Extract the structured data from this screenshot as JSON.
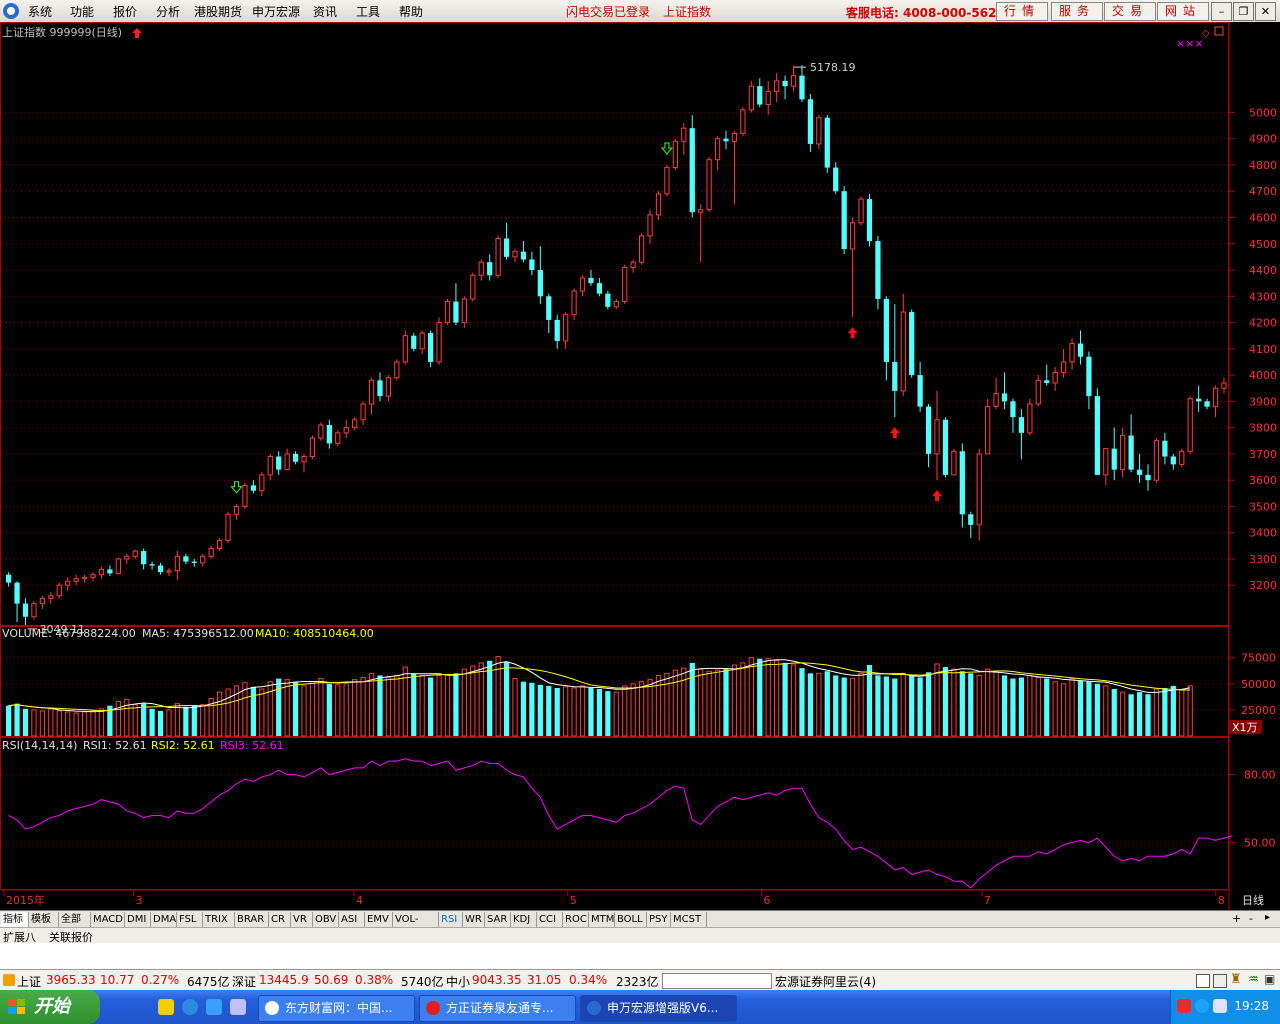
{
  "menubar": {
    "items": [
      "系统",
      "功能",
      "报价",
      "分析",
      "港股期货",
      "申万宏源",
      "资讯",
      "工具",
      "帮助"
    ],
    "status_login": "闪电交易已登录",
    "status_index": "上证指数",
    "service_phone": "客服电话: 4008-000-562",
    "nav_buttons": [
      "行情",
      "服务",
      "交易",
      "网站"
    ]
  },
  "chart_header": {
    "title": "上证指数 999999(日线)"
  },
  "volume_header": {
    "volume": "VOLUME: 467988224.00",
    "ma5": "MA5: 475396512.00",
    "ma10": "MA10: 408510464.00",
    "unit": "X1万"
  },
  "rsi_header": {
    "name": "RSI(14,14,14)",
    "rsi1": "RSI1: 52.61",
    "rsi2": "RSI2: 52.61",
    "rsi3": "RSI3: 52.61"
  },
  "chart_data": {
    "type": "candlestick",
    "title": "上证指数 999999(日线)",
    "price_axis": {
      "ticks": [
        3200,
        3300,
        3400,
        3500,
        3600,
        3700,
        3800,
        3900,
        4000,
        4100,
        4200,
        4300,
        4400,
        4500,
        4600,
        4700,
        4800,
        4900,
        5000
      ],
      "range": [
        3060,
        5230
      ]
    },
    "high_label": "5178.19",
    "low_label": "3049.11",
    "volume_axis": {
      "ticks": [
        "25000",
        "50000",
        "75000"
      ],
      "range": [
        0,
        90000
      ]
    },
    "rsi_axis": {
      "ticks": [
        "50.00",
        "80.00"
      ],
      "range": [
        30,
        90
      ]
    },
    "x_labels": [
      "2015年",
      "3",
      "4",
      "5",
      "6",
      "7",
      "8"
    ],
    "period_label": "日线",
    "ohlc": [
      [
        3240,
        3250,
        3195,
        3210
      ],
      [
        3210,
        3215,
        3060,
        3130
      ],
      [
        3130,
        3150,
        3049,
        3080
      ],
      [
        3080,
        3140,
        3070,
        3130
      ],
      [
        3130,
        3160,
        3110,
        3150
      ],
      [
        3150,
        3175,
        3130,
        3160
      ],
      [
        3160,
        3210,
        3150,
        3200
      ],
      [
        3200,
        3230,
        3180,
        3215
      ],
      [
        3215,
        3240,
        3200,
        3225
      ],
      [
        3225,
        3240,
        3210,
        3230
      ],
      [
        3230,
        3250,
        3215,
        3240
      ],
      [
        3240,
        3270,
        3225,
        3260
      ],
      [
        3260,
        3275,
        3235,
        3245
      ],
      [
        3245,
        3305,
        3240,
        3300
      ],
      [
        3300,
        3320,
        3280,
        3310
      ],
      [
        3310,
        3335,
        3300,
        3330
      ],
      [
        3330,
        3340,
        3260,
        3280
      ],
      [
        3280,
        3290,
        3260,
        3275
      ],
      [
        3275,
        3285,
        3240,
        3250
      ],
      [
        3250,
        3265,
        3235,
        3255
      ],
      [
        3255,
        3330,
        3220,
        3310
      ],
      [
        3310,
        3320,
        3280,
        3290
      ],
      [
        3290,
        3300,
        3270,
        3285
      ],
      [
        3285,
        3320,
        3270,
        3310
      ],
      [
        3310,
        3350,
        3300,
        3340
      ],
      [
        3340,
        3380,
        3330,
        3370
      ],
      [
        3370,
        3480,
        3360,
        3470
      ],
      [
        3470,
        3510,
        3450,
        3500
      ],
      [
        3500,
        3590,
        3490,
        3580
      ],
      [
        3580,
        3600,
        3550,
        3560
      ],
      [
        3560,
        3630,
        3540,
        3620
      ],
      [
        3620,
        3700,
        3600,
        3690
      ],
      [
        3690,
        3710,
        3620,
        3640
      ],
      [
        3640,
        3720,
        3640,
        3700
      ],
      [
        3700,
        3710,
        3660,
        3670
      ],
      [
        3670,
        3700,
        3630,
        3690
      ],
      [
        3690,
        3770,
        3680,
        3760
      ],
      [
        3760,
        3820,
        3750,
        3810
      ],
      [
        3810,
        3830,
        3720,
        3740
      ],
      [
        3740,
        3790,
        3730,
        3780
      ],
      [
        3780,
        3830,
        3760,
        3800
      ],
      [
        3800,
        3840,
        3790,
        3830
      ],
      [
        3830,
        3900,
        3810,
        3890
      ],
      [
        3890,
        3990,
        3850,
        3980
      ],
      [
        3980,
        4010,
        3900,
        3920
      ],
      [
        3920,
        4000,
        3900,
        3990
      ],
      [
        3990,
        4060,
        3980,
        4050
      ],
      [
        4050,
        4170,
        4040,
        4150
      ],
      [
        4150,
        4160,
        4090,
        4100
      ],
      [
        4100,
        4170,
        4080,
        4160
      ],
      [
        4160,
        4170,
        4030,
        4050
      ],
      [
        4050,
        4220,
        4040,
        4200
      ],
      [
        4200,
        4290,
        4190,
        4280
      ],
      [
        4280,
        4350,
        4190,
        4200
      ],
      [
        4200,
        4300,
        4180,
        4290
      ],
      [
        4290,
        4390,
        4280,
        4380
      ],
      [
        4380,
        4440,
        4360,
        4430
      ],
      [
        4430,
        4460,
        4360,
        4380
      ],
      [
        4380,
        4530,
        4370,
        4520
      ],
      [
        4520,
        4580,
        4440,
        4450
      ],
      [
        4450,
        4480,
        4430,
        4470
      ],
      [
        4470,
        4510,
        4430,
        4440
      ],
      [
        4440,
        4470,
        4380,
        4400
      ],
      [
        4400,
        4490,
        4270,
        4300
      ],
      [
        4300,
        4310,
        4160,
        4210
      ],
      [
        4210,
        4230,
        4100,
        4130
      ],
      [
        4130,
        4240,
        4100,
        4230
      ],
      [
        4230,
        4330,
        4210,
        4320
      ],
      [
        4320,
        4380,
        4300,
        4370
      ],
      [
        4370,
        4400,
        4340,
        4350
      ],
      [
        4350,
        4370,
        4300,
        4310
      ],
      [
        4310,
        4320,
        4250,
        4260
      ],
      [
        4260,
        4290,
        4250,
        4280
      ],
      [
        4280,
        4420,
        4270,
        4410
      ],
      [
        4410,
        4440,
        4390,
        4430
      ],
      [
        4430,
        4540,
        4420,
        4530
      ],
      [
        4530,
        4630,
        4500,
        4610
      ],
      [
        4610,
        4700,
        4590,
        4690
      ],
      [
        4690,
        4800,
        4680,
        4790
      ],
      [
        4790,
        4900,
        4780,
        4890
      ],
      [
        4890,
        4960,
        4840,
        4940
      ],
      [
        4940,
        4990,
        4600,
        4620
      ],
      [
        4620,
        4650,
        4430,
        4630
      ],
      [
        4630,
        4830,
        4620,
        4820
      ],
      [
        4820,
        4910,
        4780,
        4900
      ],
      [
        4900,
        4930,
        4860,
        4890
      ],
      [
        4890,
        4930,
        4650,
        4920
      ],
      [
        4920,
        5020,
        4910,
        5010
      ],
      [
        5010,
        5120,
        5000,
        5100
      ],
      [
        5100,
        5130,
        5020,
        5030
      ],
      [
        5030,
        5120,
        4990,
        5080
      ],
      [
        5080,
        5150,
        5040,
        5120
      ],
      [
        5120,
        5140,
        5050,
        5100
      ],
      [
        5100,
        5178,
        5080,
        5140
      ],
      [
        5140,
        5180,
        5040,
        5050
      ],
      [
        5050,
        5070,
        4850,
        4880
      ],
      [
        4880,
        4990,
        4860,
        4980
      ],
      [
        4980,
        4990,
        4770,
        4790
      ],
      [
        4790,
        4810,
        4690,
        4700
      ],
      [
        4700,
        4720,
        4460,
        4480
      ],
      [
        4480,
        4600,
        4220,
        4580
      ],
      [
        4580,
        4680,
        4570,
        4670
      ],
      [
        4670,
        4690,
        4490,
        4510
      ],
      [
        4510,
        4530,
        4250,
        4290
      ],
      [
        4290,
        4300,
        3980,
        4050
      ],
      [
        4050,
        4270,
        3840,
        3940
      ],
      [
        3940,
        4310,
        3920,
        4240
      ],
      [
        4240,
        4250,
        3990,
        4000
      ],
      [
        4000,
        4050,
        3860,
        3880
      ],
      [
        3880,
        3890,
        3650,
        3700
      ],
      [
        3700,
        3940,
        3600,
        3830
      ],
      [
        3830,
        3840,
        3610,
        3620
      ],
      [
        3620,
        3720,
        3620,
        3710
      ],
      [
        3710,
        3740,
        3420,
        3470
      ],
      [
        3470,
        3480,
        3380,
        3430
      ],
      [
        3430,
        3720,
        3370,
        3700
      ],
      [
        3700,
        3910,
        3700,
        3880
      ],
      [
        3880,
        3990,
        3870,
        3930
      ],
      [
        3930,
        4010,
        3870,
        3900
      ],
      [
        3900,
        3910,
        3780,
        3840
      ],
      [
        3840,
        3870,
        3680,
        3780
      ],
      [
        3780,
        3910,
        3770,
        3890
      ],
      [
        3890,
        4000,
        3880,
        3980
      ],
      [
        3980,
        4040,
        3960,
        3970
      ],
      [
        3970,
        4030,
        3940,
        4010
      ],
      [
        4010,
        4100,
        3990,
        4050
      ],
      [
        4050,
        4140,
        4020,
        4120
      ],
      [
        4120,
        4170,
        4040,
        4070
      ],
      [
        4070,
        4090,
        3870,
        3920
      ],
      [
        3920,
        3950,
        3620,
        3620
      ],
      [
        3620,
        3720,
        3580,
        3720
      ],
      [
        3720,
        3800,
        3600,
        3640
      ],
      [
        3640,
        3800,
        3610,
        3770
      ],
      [
        3770,
        3850,
        3630,
        3640
      ],
      [
        3640,
        3700,
        3590,
        3620
      ],
      [
        3620,
        3660,
        3560,
        3600
      ],
      [
        3600,
        3760,
        3590,
        3750
      ],
      [
        3750,
        3780,
        3660,
        3690
      ],
      [
        3690,
        3700,
        3640,
        3660
      ],
      [
        3660,
        3720,
        3650,
        3710
      ],
      [
        3710,
        3920,
        3700,
        3910
      ],
      [
        3910,
        3960,
        3860,
        3900
      ],
      [
        3900,
        3910,
        3870,
        3880
      ],
      [
        3880,
        3960,
        3840,
        3950
      ],
      [
        3950,
        3990,
        3930,
        3970
      ]
    ],
    "volume": [
      29000,
      31000,
      26000,
      25000,
      24000,
      26000,
      24000,
      23000,
      22000,
      23000,
      24000,
      26000,
      29000,
      33000,
      35000,
      30000,
      31000,
      26000,
      24000,
      25000,
      31000,
      28000,
      29000,
      30000,
      36000,
      42000,
      45000,
      48000,
      51000,
      47000,
      45000,
      52000,
      55000,
      54000,
      52000,
      48000,
      52000,
      55000,
      50000,
      49000,
      50000,
      54000,
      56000,
      60000,
      58000,
      56000,
      58000,
      66000,
      60000,
      58000,
      56000,
      58000,
      59000,
      60000,
      64000,
      67000,
      70000,
      72000,
      76000,
      71000,
      55000,
      52000,
      51000,
      49000,
      48000,
      46000,
      47000,
      46000,
      48000,
      46000,
      45000,
      43000,
      42000,
      48000,
      50000,
      52000,
      54000,
      58000,
      60000,
      63000,
      65000,
      70000,
      64000,
      62000,
      63000,
      64000,
      68000,
      70000,
      75000,
      74000,
      74000,
      72000,
      70000,
      68000,
      65000,
      60000,
      60000,
      62000,
      58000,
      56000,
      55000,
      60000,
      68000,
      58000,
      57000,
      55000,
      60000,
      58000,
      56000,
      61000,
      69000,
      66000,
      64000,
      62000,
      60000,
      58000,
      64000,
      62000,
      58000,
      55000,
      56000,
      58000,
      56000,
      55000,
      52000,
      50000,
      55000,
      53000,
      52000,
      50000,
      48000,
      45000,
      42000,
      40000,
      42000,
      40000,
      45000,
      46000,
      48000,
      44000,
      48000
    ],
    "rsi": [
      62,
      60,
      56,
      57,
      59,
      61,
      62,
      64,
      65,
      66,
      67,
      69,
      68,
      67,
      64,
      63,
      61,
      62,
      62,
      61,
      64,
      63,
      63,
      65,
      68,
      71,
      73,
      76,
      78,
      77,
      79,
      80,
      82,
      80,
      80,
      79,
      81,
      83,
      80,
      81,
      82,
      83,
      83,
      86,
      84,
      86,
      86,
      87,
      86,
      86,
      84,
      85,
      86,
      82,
      83,
      84,
      86,
      85,
      85,
      82,
      80,
      79,
      74,
      70,
      62,
      56,
      58,
      60,
      62,
      62,
      61,
      60,
      59,
      62,
      63,
      65,
      67,
      70,
      73,
      75,
      74,
      60,
      58,
      62,
      66,
      68,
      70,
      69,
      70,
      71,
      72,
      71,
      73,
      74,
      74,
      67,
      61,
      59,
      56,
      51,
      47,
      48,
      46,
      44,
      41,
      38,
      39,
      36,
      37,
      38,
      36,
      35,
      33,
      33,
      30,
      34,
      37,
      40,
      42,
      44,
      44,
      44,
      46,
      45,
      47,
      49,
      50,
      51,
      50,
      52,
      48,
      44,
      42,
      43,
      42,
      44,
      44,
      44,
      45,
      47,
      45,
      52,
      52,
      51,
      52,
      53
    ]
  },
  "tabs": [
    "指标",
    "模板",
    "全部",
    "MACD",
    "DMI",
    "DMA",
    "FSL",
    "TRIX",
    "BRAR",
    "CR",
    "VR",
    "OBV",
    "ASI",
    "EMV",
    "VOL-TDX",
    "RSI",
    "WR",
    "SAR",
    "KDJ",
    "CCI",
    "ROC",
    "MTM",
    "BOLL",
    "PSY",
    "MCST"
  ],
  "subbar": {
    "expand": "扩展八",
    "linked": "关联报价"
  },
  "quote": {
    "sh_label": "上证",
    "sh_price": "3965.33",
    "sh_change": "10.77",
    "sh_pct": "0.27%",
    "sh_amount": "6475亿",
    "sz_label": "深证",
    "sz_price": "13445.9",
    "sz_change": "50.69",
    "sz_pct": "0.38%",
    "sz_amount": "5740亿",
    "zx_label": "中小",
    "zx_price": "9043.35",
    "zx_change": "31.05",
    "zx_pct": "0.34%",
    "zx_amount": "2323亿",
    "broker": "宏源证券阿里云(4)"
  },
  "taskbar": {
    "start": "开始",
    "tasks": [
      "东方财富网：中国...",
      "方正证券泉友通专...",
      "申万宏源增强版V6..."
    ],
    "clock": "19:28"
  },
  "colors": {
    "up": "#ff3c3c",
    "down": "#54ffff",
    "ma5": "#ffffff",
    "ma10": "#ffff00",
    "rsi": "#ff00ff",
    "grid": "#8a0000"
  }
}
